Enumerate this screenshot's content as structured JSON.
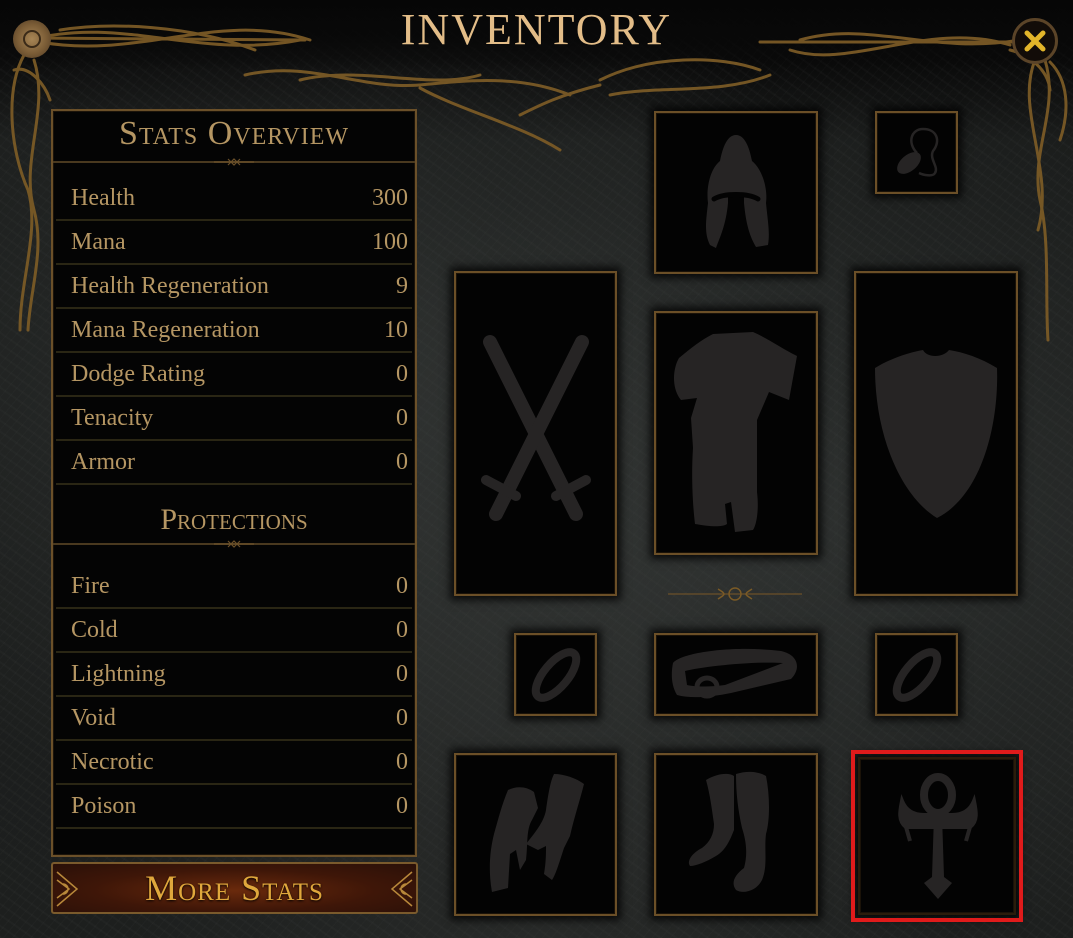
{
  "window": {
    "title": "INVENTORY",
    "close_icon": "close-x-icon"
  },
  "stats_overview": {
    "heading": "Stats Overview",
    "rows": [
      {
        "label": "Health",
        "value": "300"
      },
      {
        "label": "Mana",
        "value": "100"
      },
      {
        "label": "Health Regeneration",
        "value": "9"
      },
      {
        "label": "Mana Regeneration",
        "value": "10"
      },
      {
        "label": "Dodge Rating",
        "value": "0"
      },
      {
        "label": "Tenacity",
        "value": "0"
      },
      {
        "label": "Armor",
        "value": "0"
      }
    ]
  },
  "protections": {
    "heading": "Protections",
    "rows": [
      {
        "label": "Fire",
        "value": "0"
      },
      {
        "label": "Cold",
        "value": "0"
      },
      {
        "label": "Lightning",
        "value": "0"
      },
      {
        "label": "Void",
        "value": "0"
      },
      {
        "label": "Necrotic",
        "value": "0"
      },
      {
        "label": "Poison",
        "value": "0"
      }
    ]
  },
  "more_stats_button": {
    "label": "More Stats"
  },
  "equipment_slots": [
    {
      "slot": "helmet",
      "icon": "helmet-icon",
      "state": "empty"
    },
    {
      "slot": "amulet",
      "icon": "amulet-icon",
      "state": "empty"
    },
    {
      "slot": "main-hand",
      "icon": "crossed-swords-icon",
      "state": "empty"
    },
    {
      "slot": "body-armor",
      "icon": "body-armor-icon",
      "state": "empty"
    },
    {
      "slot": "off-hand",
      "icon": "shield-icon",
      "state": "empty"
    },
    {
      "slot": "ring-left",
      "icon": "ring-icon",
      "state": "empty"
    },
    {
      "slot": "belt",
      "icon": "belt-icon",
      "state": "empty"
    },
    {
      "slot": "ring-right",
      "icon": "ring-icon",
      "state": "empty"
    },
    {
      "slot": "gloves",
      "icon": "gloves-icon",
      "state": "empty"
    },
    {
      "slot": "boots",
      "icon": "boots-icon",
      "state": "empty"
    },
    {
      "slot": "relic",
      "icon": "ankh-icon",
      "state": "empty",
      "highlighted": true
    }
  ],
  "colors": {
    "gold_text": "#b59663",
    "title_text": "#e3bd88",
    "button_text": "#e0a83c",
    "slot_border": "#6b4f27",
    "silhouette": "#262424",
    "highlight": "#e01b1b",
    "close_x": "#e2b52a"
  }
}
